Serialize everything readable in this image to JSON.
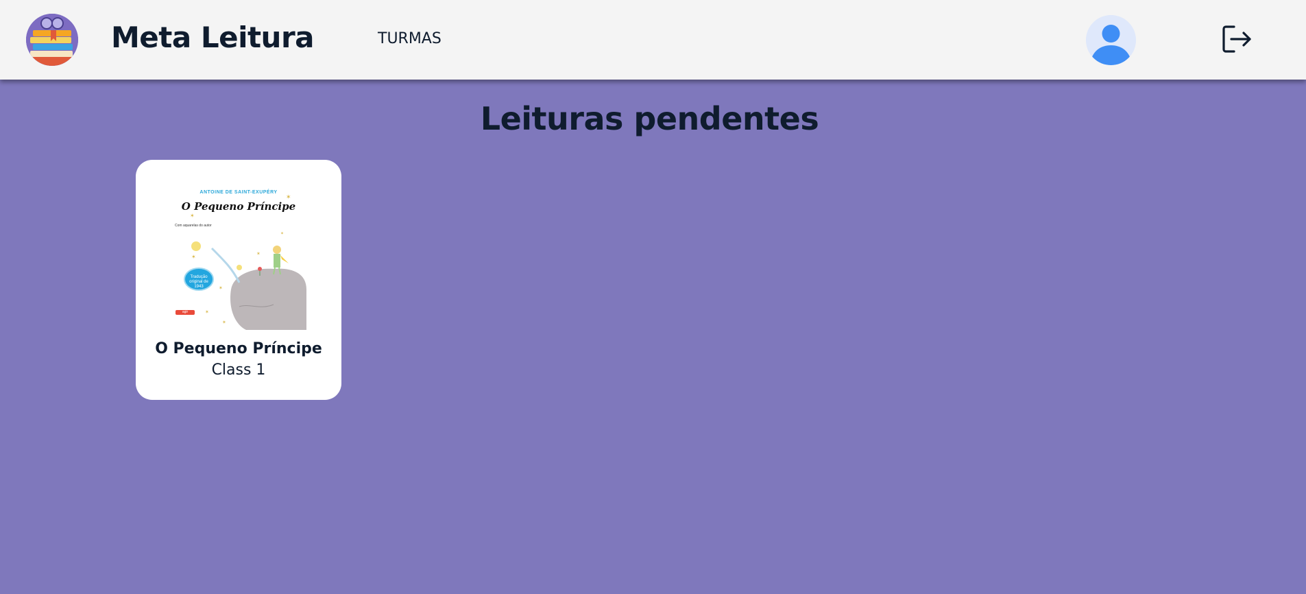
{
  "header": {
    "app_title": "Meta Leitura",
    "nav": [
      {
        "label": "TURMAS"
      }
    ],
    "logo_icon": "books-stack-logo-icon",
    "avatar_icon": "user-avatar-icon",
    "logout_icon": "logout-icon"
  },
  "main": {
    "page_title": "Leituras pendentes",
    "readings": [
      {
        "title": "O Pequeno Príncipe",
        "class_name": "Class 1",
        "cover": {
          "author": "ANTOINE DE SAINT-EXUPÉRY",
          "title": "O Pequeno Príncipe",
          "subtitle": "Com aquarelas do autor",
          "badge": "Tradução original de 1943",
          "publisher": "agir"
        }
      }
    ]
  },
  "colors": {
    "background": "#7f78bc",
    "header_bg": "#f4f4f4",
    "text": "#0f1c2e",
    "card_bg": "#ffffff",
    "avatar_bg": "#dfe8fb",
    "avatar_fg": "#3f8ef5",
    "logo_bg": "#7d6cc2"
  }
}
